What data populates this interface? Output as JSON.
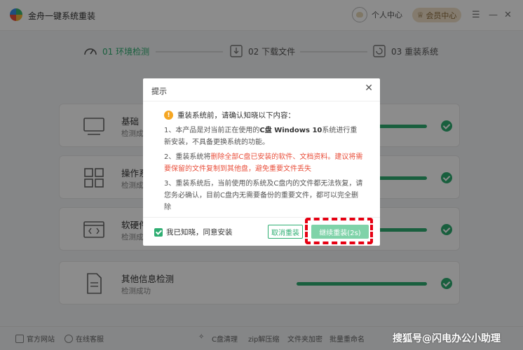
{
  "app": {
    "title": "金舟一键系统重装"
  },
  "header": {
    "user_label": "个人中心",
    "vip_label": "会员中心"
  },
  "steps": [
    {
      "label": "01 环境检测"
    },
    {
      "label": "02 下载文件"
    },
    {
      "label": "03 重装系统"
    }
  ],
  "cards": [
    {
      "name": "基础",
      "status": "检测成",
      "progress": 1.0
    },
    {
      "name": "操作系",
      "status": "检测成",
      "progress": 1.0
    },
    {
      "name": "软硬件",
      "status": "检测成",
      "progress": 1.0
    },
    {
      "name": "其他信息检测",
      "status": "检测成功",
      "progress": 1.0
    }
  ],
  "footer": {
    "site": "官方网站",
    "service": "在线客服",
    "tools": [
      "C盘清理",
      "zip解压缩",
      "文件夹加密",
      "批量重命名"
    ]
  },
  "dialog": {
    "title": "提示",
    "heading": "重装系统前，请确认知晓以下内容：",
    "p1_a": "1、本产品是对当前正在使用的",
    "p1_b": "C盘 Windows 10",
    "p1_c": "系统进行重新安装，不具备更换系统的功能。",
    "p2_a": "2、重装系统将",
    "p2_b": "删除全部C盘已安装的软件、文档资料。建议将需要保留的文件复制到其他盘，避免重要文件丢失",
    "p3": "3、重装系统后，当前使用的系统及C盘内的文件都无法恢复，请您务必确认，目前C盘内无需要备份的重要文件，都可以完全删除",
    "agree_label": "我已知晓，同意安装",
    "cancel_label": "取消重装",
    "ok_label": "继续重装(2s)"
  },
  "watermark": "搜狐号@闪电办公小助理",
  "colors": {
    "accent": "#2fae72",
    "warning": "#e9503c",
    "highlight": "#e60012"
  }
}
